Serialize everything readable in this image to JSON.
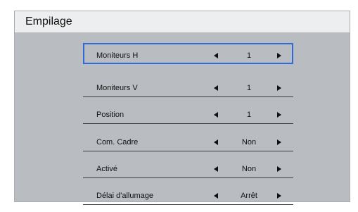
{
  "window": {
    "title": "Empilage"
  },
  "menu": {
    "items": [
      {
        "label": "Moniteurs H",
        "value": "1",
        "selected": true
      },
      {
        "label": "Moniteurs V",
        "value": "1",
        "selected": false
      },
      {
        "label": "Position",
        "value": "1",
        "selected": false
      },
      {
        "label": "Com. Cadre",
        "value": "Non",
        "selected": false
      },
      {
        "label": "Activé",
        "value": "Non",
        "selected": false
      },
      {
        "label": "Délai d'allumage",
        "value": "Arrêt",
        "selected": false
      }
    ]
  },
  "colors": {
    "panel_background": "#b9bdc1",
    "title_bar_background": "#eceeef",
    "selection_border": "#2f6bd6",
    "text": "#101010"
  },
  "icons": {
    "decrease": "triangle-left-icon",
    "increase": "triangle-right-icon"
  }
}
